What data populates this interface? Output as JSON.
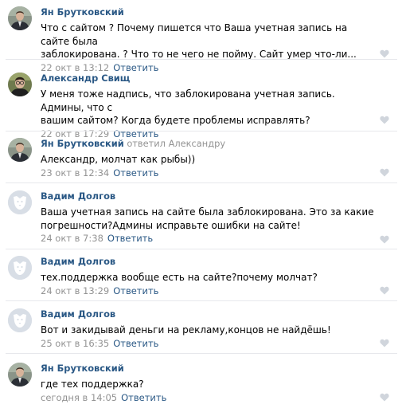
{
  "comments": [
    {
      "author": "Ян Брутковский",
      "reply_to": "",
      "text": "Что с сайтом ? Почему пишется что Ваша учетная запись на сайте была\nзаблокирована. ? Что то не чего не пойму. Сайт умер что-ли...",
      "date": "22 окт в 13:12",
      "reply_label": "Ответить",
      "avatar_icon": "user-photo-man-suit",
      "like_icon": "heart-icon"
    },
    {
      "author": "Александр Свищ",
      "reply_to": "",
      "text": "У меня тоже надпись, что заблокирована учетная запись. Админы, что с\nвашим сайтом? Когда будете проблемы исправлять?",
      "date": "22 окт в 17:29",
      "reply_label": "Ответить",
      "avatar_icon": "user-photo-man-glasses",
      "like_icon": "heart-icon"
    },
    {
      "author": "Ян Брутковский",
      "reply_to": "ответил Александру",
      "text": "Александр, молчат как рыбы))",
      "date": "23 окт в 12:34",
      "reply_label": "Ответить",
      "avatar_icon": "user-photo-man-suit",
      "like_icon": "heart-icon"
    },
    {
      "author": "Вадим Долгов",
      "reply_to": "",
      "text": "Ваша учетная запись на сайте была заблокирована. Это за какие\nпогрешности?Админы исправьте ошибки на сайте!",
      "date": "24 окт в 7:38",
      "reply_label": "Ответить",
      "avatar_icon": "default-dog-avatar",
      "like_icon": "heart-icon"
    },
    {
      "author": "Вадим Долгов",
      "reply_to": "",
      "text": "тех.поддержка вообще есть на сайте?почему молчат?",
      "date": "24 окт в 13:29",
      "reply_label": "Ответить",
      "avatar_icon": "default-dog-avatar",
      "like_icon": "heart-icon"
    },
    {
      "author": "Вадим Долгов",
      "reply_to": "",
      "text": "Вот и закидывай деньги на рекламу,концов не найдёшь!",
      "date": "25 окт в 16:35",
      "reply_label": "Ответить",
      "avatar_icon": "default-dog-avatar",
      "like_icon": "heart-icon"
    },
    {
      "author": "Ян Брутковский",
      "reply_to": "",
      "text": "где тех поддержка?",
      "date": "сегодня в 14:05",
      "reply_label": "Ответить",
      "avatar_icon": "user-photo-man-suit",
      "like_icon": "heart-icon"
    }
  ],
  "colors": {
    "link": "#2a5885",
    "muted": "#939393",
    "divider": "#e7e8ec",
    "like": "#d0d5dc"
  }
}
